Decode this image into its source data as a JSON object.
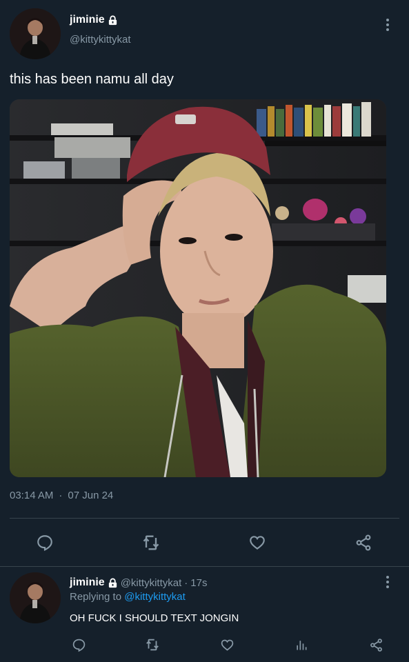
{
  "tweet": {
    "author_name": "jiminie",
    "author_handle": "@kittykittykat",
    "text": "this has been namu all day",
    "time": "03:14 AM",
    "separator": "·",
    "date": "07 Jun 24"
  },
  "reply": {
    "author_name": "jiminie",
    "author_handle": "@kittykittykat",
    "separator": "·",
    "age": "17s",
    "replying_prefix": "Replying to",
    "replying_to": "@kittykittykat",
    "text": "OH FUCK I SHOULD TEXT JONGIN"
  },
  "icons": {
    "lock": "lock-icon",
    "more": "more-vertical-icon",
    "reply": "reply-icon",
    "retweet": "retweet-icon",
    "like": "heart-icon",
    "share": "share-icon",
    "analytics": "analytics-icon"
  },
  "colors": {
    "background": "#15202b",
    "secondary_text": "#8899a6",
    "link": "#1d9bf0",
    "divider": "#38444d"
  }
}
